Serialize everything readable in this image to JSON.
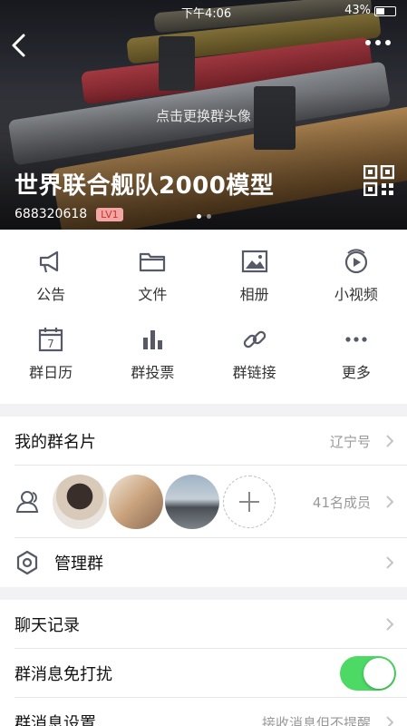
{
  "status_bar": {
    "time": "下午4:06",
    "battery": "43%"
  },
  "header": {
    "change_avatar_hint": "点击更换群头像",
    "group_name": "世界联合舰队2000模型",
    "group_id": "688320618",
    "level": "LV1"
  },
  "features": [
    {
      "label": "公告",
      "icon": "megaphone-icon"
    },
    {
      "label": "文件",
      "icon": "folder-icon"
    },
    {
      "label": "相册",
      "icon": "photo-album-icon"
    },
    {
      "label": "小视频",
      "icon": "video-icon"
    },
    {
      "label": "群日历",
      "icon": "calendar-icon"
    },
    {
      "label": "群投票",
      "icon": "bar-chart-icon"
    },
    {
      "label": "群链接",
      "icon": "link-icon"
    },
    {
      "label": "更多",
      "icon": "more-icon"
    }
  ],
  "calendar_day": "7",
  "rows": {
    "my_card": {
      "title": "我的群名片",
      "value": "辽宁号"
    },
    "members": {
      "count": "41名成员"
    },
    "manage": {
      "title": "管理群"
    },
    "chat_history": {
      "title": "聊天记录"
    },
    "dnd": {
      "title": "群消息免打扰",
      "enabled": true
    },
    "msg_settings": {
      "title": "群消息设置",
      "value": "接收消息但不提醒"
    }
  },
  "colors": {
    "toggle_on": "#4cd964",
    "level_badge": "#f4a6a6",
    "icon": "#555a66"
  }
}
